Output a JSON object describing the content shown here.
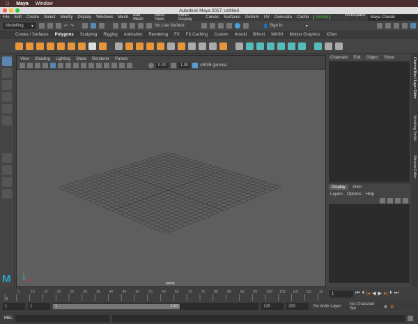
{
  "mac_menu": {
    "apple_icon": "apple-icon",
    "items": [
      "Maya",
      "Window"
    ]
  },
  "window": {
    "title": "Autodesk Maya 2017: untitled"
  },
  "menubar": {
    "items": [
      "File",
      "Edit",
      "Create",
      "Select",
      "Modify",
      "Display",
      "Windows",
      "Mesh",
      "Edit Mesh",
      "Mesh Tools",
      "Mesh Display",
      "Curves",
      "Surfaces",
      "Deform",
      "UV",
      "Generate",
      "Cache"
    ],
    "arnold": "Arnold",
    "workspace_label": "Workspace :",
    "workspace_value": "Maya Classic"
  },
  "status_line": {
    "mode": "Modelling",
    "live_surface": "No Live Surface",
    "sign_in": "Sign In"
  },
  "shelf_tabs": {
    "items": [
      "Curves / Surfaces",
      "Polygons",
      "Sculpting",
      "Rigging",
      "Animation",
      "Rendering",
      "FX",
      "FX Caching",
      "Custom",
      "Arnold",
      "Bifrost",
      "MASH",
      "Motion Graphics",
      "XGen"
    ],
    "active": "Polygons"
  },
  "viewport": {
    "menu": [
      "View",
      "Shading",
      "Lighting",
      "Show",
      "Renderer",
      "Panels"
    ],
    "exposure": "0.00",
    "gamma": "1.00",
    "color_space": "sRGB gamma",
    "camera_label": "persp",
    "accent": "#5a9fd4"
  },
  "channel_box": {
    "menu": [
      "Channels",
      "Edit",
      "Object",
      "Show"
    ]
  },
  "layer_editor": {
    "tabs": [
      "Display",
      "Anim"
    ],
    "active": "Display",
    "menu": [
      "Layers",
      "Options",
      "Help"
    ]
  },
  "side_tabs": [
    "Channel Box / Layer Editor",
    "Modeling Toolkit",
    "Attribute Editor"
  ],
  "timeline": {
    "ticks": [
      "1",
      "5",
      "10",
      "15",
      "20",
      "25",
      "30",
      "35",
      "40",
      "45",
      "50",
      "55",
      "60",
      "65",
      "70",
      "75",
      "80",
      "85",
      "90",
      "95",
      "100",
      "105",
      "110",
      "115",
      "12"
    ],
    "current_frame": "1"
  },
  "range": {
    "start": "1",
    "playback_start": "1",
    "slider_start": "1",
    "slider_end": "120",
    "playback_end": "120",
    "end": "200",
    "anim_layer": "No Anim Layer",
    "character_set": "No Character Set"
  },
  "command_line": {
    "label": "MEL"
  }
}
